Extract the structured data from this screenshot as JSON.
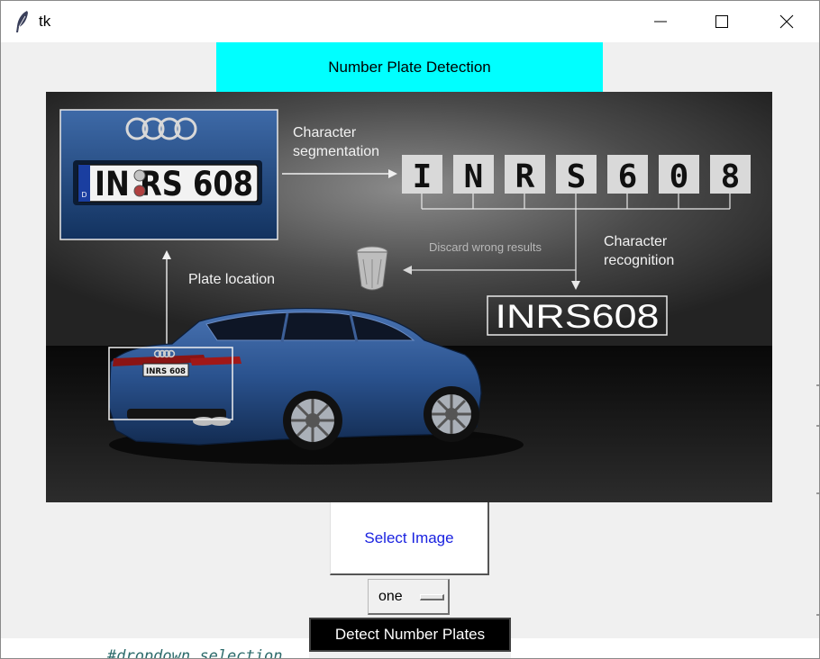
{
  "window": {
    "title": "tk",
    "icons": {
      "app": "tk-feather-icon",
      "minimize": "minimize-icon",
      "maximize": "maximize-icon",
      "close": "close-icon"
    }
  },
  "header": {
    "label": "Number Plate Detection",
    "bg_color": "#00ffff"
  },
  "illustration": {
    "segmentation_label_1": "Character",
    "segmentation_label_2": "segmentation",
    "characters": [
      "I",
      "N",
      "R",
      "S",
      "6",
      "0",
      "8"
    ],
    "plate_text": "INRS608",
    "closeup_plate_text": "IN RS 608",
    "closeup_plate_country": "D",
    "car_plate_text": "INRS 608",
    "discard_label": "Discard wrong results",
    "recognition_label_1": "Character",
    "recognition_label_2": "recognition",
    "plate_location_label": "Plate location",
    "result_text": "INRS608"
  },
  "select_button": {
    "label": "Select Image",
    "text_color": "#1a22e0"
  },
  "dropdown": {
    "selected": "one"
  },
  "detect_button": {
    "label": "Detect Number Plates"
  },
  "background_code": {
    "text": "#dropdown selection"
  }
}
